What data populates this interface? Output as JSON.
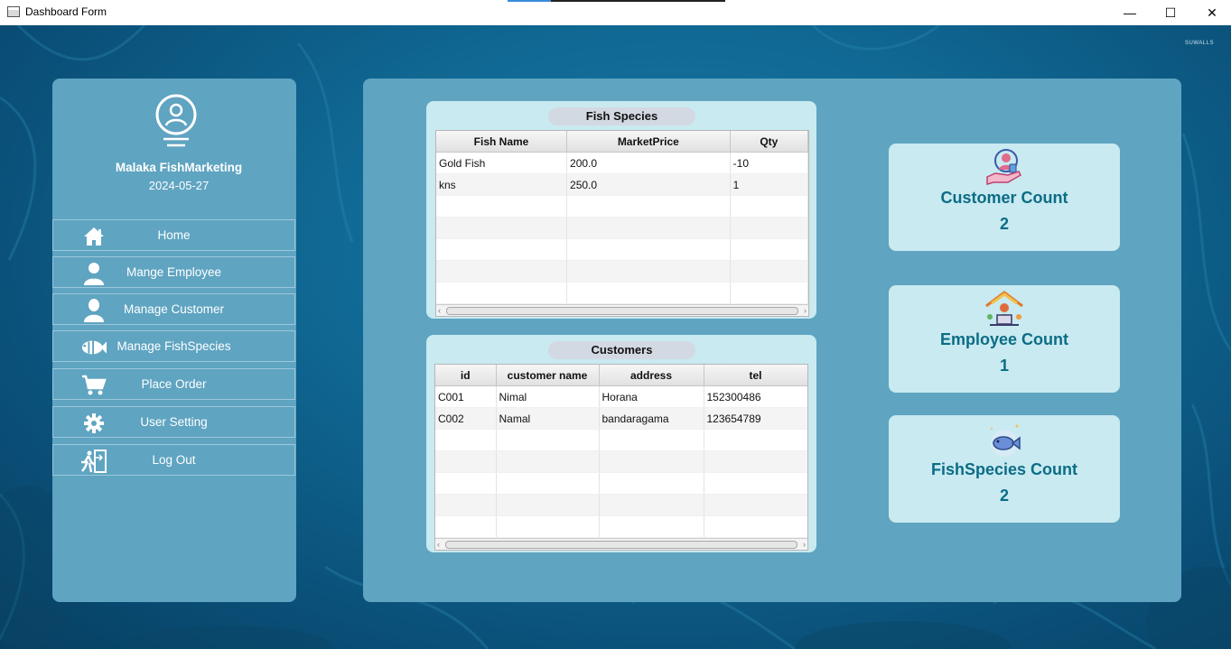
{
  "window": {
    "title": "Dashboard Form",
    "controls": {
      "minimize": "—",
      "maximize": "☐",
      "close": "✕"
    }
  },
  "watermark": "SUWALLS",
  "sidebar": {
    "company": "Malaka FishMarketing",
    "date": "2024-05-27",
    "items": [
      {
        "label": "Home",
        "icon": "home-icon"
      },
      {
        "label": "Mange Employee",
        "icon": "employee-icon"
      },
      {
        "label": "Manage Customer",
        "icon": "customer-icon"
      },
      {
        "label": "Manage FishSpecies",
        "icon": "fish-icon"
      },
      {
        "label": "Place Order",
        "icon": "cart-icon"
      },
      {
        "label": "User Setting",
        "icon": "gear-icon"
      },
      {
        "label": "Log Out",
        "icon": "exit-icon"
      }
    ]
  },
  "fish_species": {
    "title": "Fish Species",
    "columns": [
      "Fish Name",
      "MarketPrice",
      "Qty"
    ],
    "rows": [
      [
        "Gold Fish",
        "200.0",
        "-10"
      ],
      [
        "kns",
        "250.0",
        "1"
      ]
    ]
  },
  "customers": {
    "title": "Customers",
    "columns": [
      "id",
      "customer name",
      "address",
      "tel"
    ],
    "rows": [
      [
        "C001",
        "Nimal",
        "Horana",
        "152300486"
      ],
      [
        "C002",
        "Namal",
        "bandaragama",
        "123654789"
      ]
    ]
  },
  "counts": [
    {
      "label": "Customer Count",
      "value": "2",
      "icon": "customer-service-icon"
    },
    {
      "label": "Employee Count",
      "value": "1",
      "icon": "work-from-home-icon"
    },
    {
      "label": "FishSpecies Count",
      "value": "2",
      "icon": "fish-icon"
    }
  ],
  "colors": {
    "panel": "#5fa4c1",
    "card": "#c8eaf0",
    "accent_text": "#0c6c86"
  }
}
